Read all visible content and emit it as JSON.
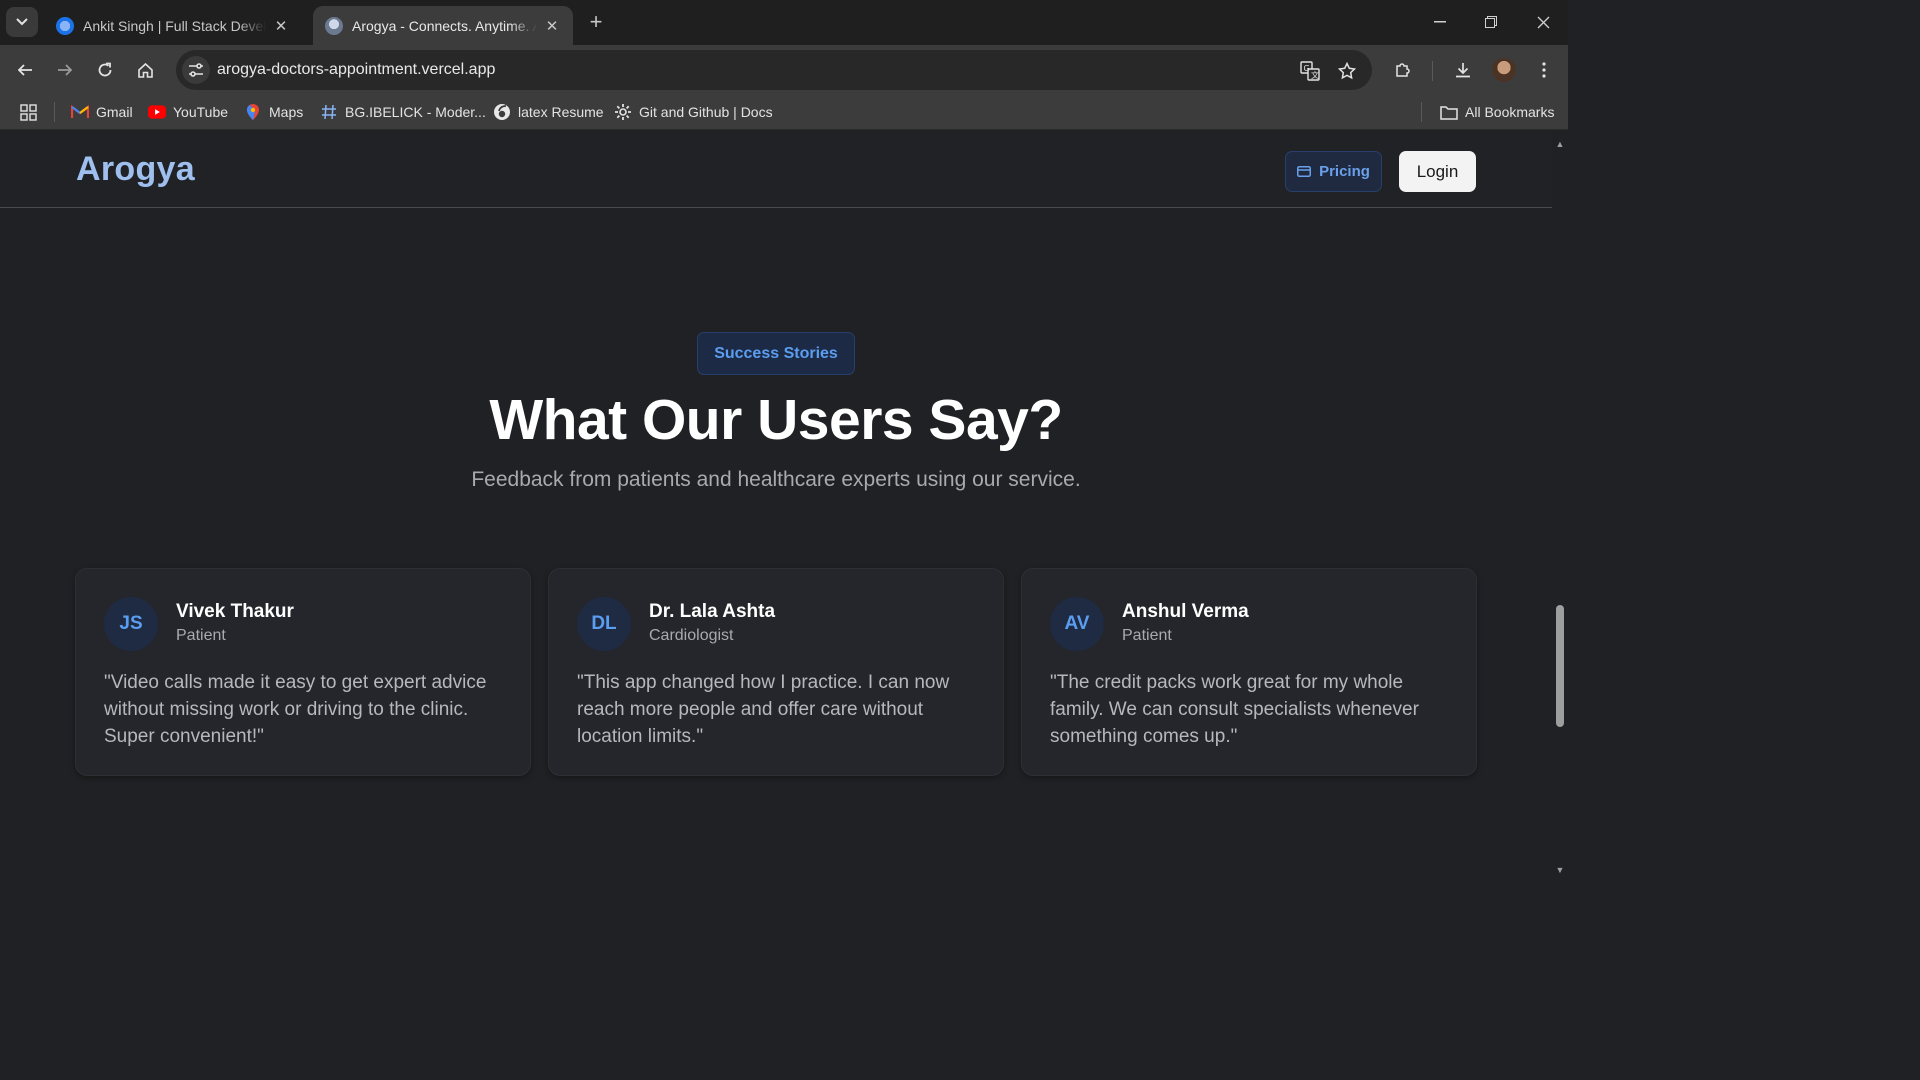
{
  "browser": {
    "tabs": [
      {
        "title": "Ankit Singh | Full Stack Developer",
        "active": false
      },
      {
        "title": "Arogya - Connects. Anytime. Anywhere.",
        "active": true
      }
    ],
    "url": "arogya-doctors-appointment.vercel.app",
    "bookmarks": [
      {
        "label": "Gmail",
        "icon": "gmail-icon"
      },
      {
        "label": "YouTube",
        "icon": "youtube-icon"
      },
      {
        "label": "Maps",
        "icon": "maps-icon"
      },
      {
        "label": "BG.IBELICK - Moder...",
        "icon": "hash-icon"
      },
      {
        "label": "latex Resume",
        "icon": "overleaf-icon"
      },
      {
        "label": "Git and Github | Docs",
        "icon": "gear-icon"
      }
    ],
    "all_bookmarks_label": "All Bookmarks"
  },
  "site": {
    "logo": "Arogya",
    "pricing_label": "Pricing",
    "login_label": "Login",
    "badge": "Success Stories",
    "headline": "What Our Users Say?",
    "subheadline": "Feedback from patients and healthcare experts using our service.",
    "testimonials": [
      {
        "initials": "JS",
        "name": "Vivek Thakur",
        "role": "Patient",
        "quote": "\"Video calls made it easy to get expert advice without missing work or driving to the clinic. Super convenient!\""
      },
      {
        "initials": "DL",
        "name": "Dr. Lala Ashta",
        "role": "Cardiologist",
        "quote": "\"This app changed how I practice. I can now reach more people and offer care without location limits.\""
      },
      {
        "initials": "AV",
        "name": "Anshul Verma",
        "role": "Patient",
        "quote": "\"The credit packs work great for my whole family. We can consult specialists whenever something comes up.\""
      }
    ]
  },
  "colors": {
    "accent": "#5b9df0",
    "logo": "#9fc0ef",
    "background": "#202124"
  }
}
